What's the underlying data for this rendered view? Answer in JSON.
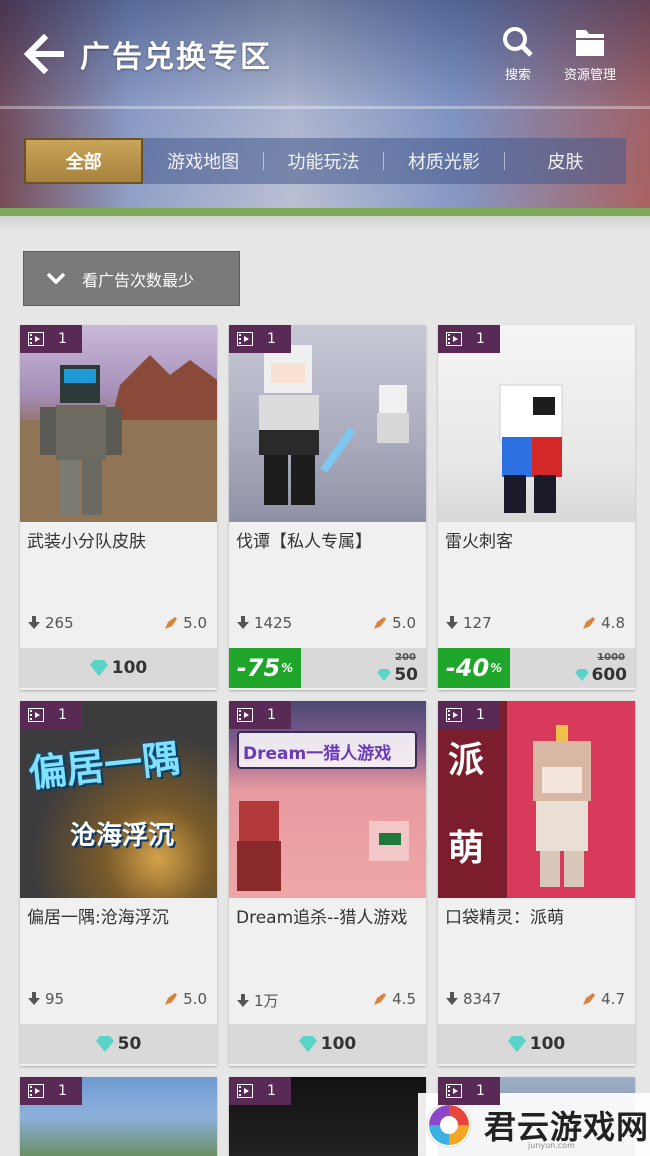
{
  "header": {
    "title": "广告兑换专区",
    "search_label": "搜索",
    "resource_label": "资源管理"
  },
  "tabs": [
    "全部",
    "游戏地图",
    "功能玩法",
    "材质光影",
    "皮肤"
  ],
  "sort": {
    "label": "看广告次数最少"
  },
  "cards": [
    {
      "badge": "1",
      "title": "武装小分队皮肤",
      "downloads": "265",
      "rating": "5.0",
      "price": "100"
    },
    {
      "badge": "1",
      "title": "伐谭【私人专属】",
      "downloads": "1425",
      "rating": "5.0",
      "discount": "-75",
      "discount_unit": "%",
      "original_price": "200",
      "price": "50"
    },
    {
      "badge": "1",
      "title": "雷火刺客",
      "downloads": "127",
      "rating": "4.8",
      "discount": "-40",
      "discount_unit": "%",
      "original_price": "1000",
      "price": "600"
    },
    {
      "badge": "1",
      "title": "偏居一隅:沧海浮沉",
      "downloads": "95",
      "rating": "5.0",
      "price": "50",
      "art_line1": "偏居一隅",
      "art_line2": "沧海浮沉"
    },
    {
      "badge": "1",
      "title": "Dream追杀--猎人游戏",
      "downloads": "1万",
      "rating": "4.5",
      "price": "100",
      "art_line1": "Dream一猎人游戏"
    },
    {
      "badge": "1",
      "title": "口袋精灵：派萌",
      "downloads": "8347",
      "rating": "4.7",
      "price": "100",
      "art_line1": "派",
      "art_line2": "萌"
    },
    {
      "badge": "1"
    },
    {
      "badge": "1"
    },
    {
      "badge": "1"
    }
  ],
  "watermark": {
    "text": "君云游戏网",
    "sub": "junyun.com"
  },
  "colors": {
    "tab_active": "#b08a44",
    "discount_green": "#1fa52a",
    "badge_purple": "#5a2a56",
    "price_bar": "#d9d9d9"
  }
}
